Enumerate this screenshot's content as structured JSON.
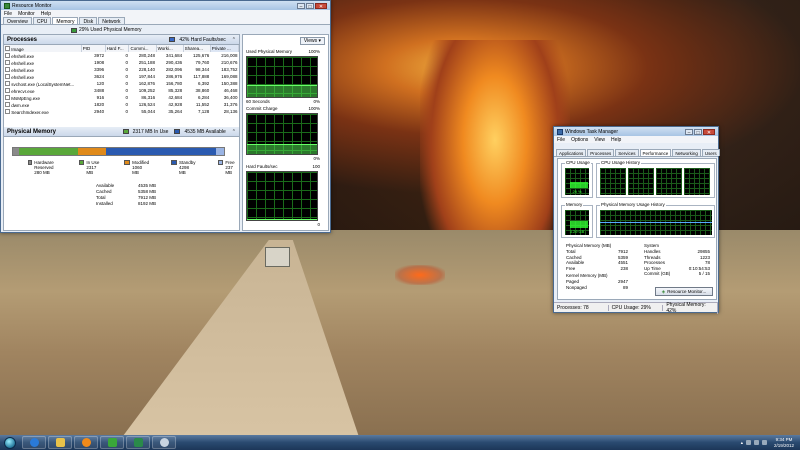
{
  "resmon": {
    "title": "Resource Monitor",
    "menu": [
      "File",
      "Monitor",
      "Help"
    ],
    "tabs": [
      "Overview",
      "CPU",
      "Memory",
      "Disk",
      "Network"
    ],
    "active_tab": "Memory",
    "status": "29% Used Physical Memory",
    "processes": {
      "header": "Processes",
      "status": "42% Hard Faults/sec",
      "columns": [
        "Image",
        "PID",
        "Hard F...",
        "Commi...",
        "Worki...",
        "Sharea...",
        "Private ..."
      ],
      "rows": [
        [
          "ehshell.exe",
          "3972",
          "0",
          "280,248",
          "341,684",
          "125,676",
          "216,008"
        ],
        [
          "ehshell.exe",
          "1908",
          "0",
          "251,188",
          "290,436",
          "79,760",
          "210,676"
        ],
        [
          "ehshell.exe",
          "3396",
          "0",
          "228,140",
          "282,096",
          "98,344",
          "183,752"
        ],
        [
          "ehshell.exe",
          "3624",
          "0",
          "197,844",
          "286,976",
          "117,888",
          "169,088"
        ],
        [
          "svchost.exe (LocalSystemNet...",
          "120",
          "0",
          "162,876",
          "156,780",
          "6,392",
          "150,388"
        ],
        [
          "ehrecvr.exe",
          "3488",
          "0",
          "109,252",
          "85,328",
          "38,860",
          "46,468"
        ],
        [
          "MsMpEng.exe",
          "916",
          "0",
          "86,316",
          "42,684",
          "6,284",
          "36,400"
        ],
        [
          "dwm.exe",
          "1820",
          "0",
          "126,524",
          "42,928",
          "11,552",
          "31,376"
        ],
        [
          "SearchIndexer.exe",
          "2940",
          "0",
          "55,044",
          "35,264",
          "7,128",
          "28,136"
        ]
      ]
    },
    "physical_memory": {
      "header": "Physical Memory",
      "in_use_label": "2317 MB In Use",
      "available_label": "4535 MB Available",
      "legend": [
        {
          "name": "Hardware Reserved",
          "value": "280 MB",
          "color": "#8a8a8a"
        },
        {
          "name": "In Use",
          "value": "2317 MB",
          "color": "#5aa83a"
        },
        {
          "name": "Modified",
          "value": "1060 MB",
          "color": "#e08a1a"
        },
        {
          "name": "Standby",
          "value": "4298 MB",
          "color": "#2a5ab0"
        },
        {
          "name": "Free",
          "value": "237 MB",
          "color": "#9ab4e4"
        }
      ],
      "bar_fractions": [
        0.03,
        0.28,
        0.13,
        0.52,
        0.04
      ],
      "totals": [
        {
          "label": "Available",
          "value": "4535 MB"
        },
        {
          "label": "Cached",
          "value": "5358 MB"
        },
        {
          "label": "Total",
          "value": "7912 MB"
        },
        {
          "label": "Installed",
          "value": "8192 MB"
        }
      ]
    },
    "graphs": {
      "views_label": "Views",
      "used_physical": {
        "label": "Used Physical Memory",
        "max": "100%",
        "min": "0%",
        "level": 0.29,
        "time": "60 Seconds"
      },
      "commit_charge": {
        "label": "Commit Charge",
        "max": "100%",
        "min": "0%",
        "level": 0.25
      },
      "hard_faults": {
        "label": "Hard Faults/sec",
        "max": "100",
        "min": "0",
        "level": 0.02
      }
    }
  },
  "taskmgr": {
    "title": "Windows Task Manager",
    "menu": [
      "File",
      "Options",
      "View",
      "Help"
    ],
    "tabs": [
      "Applications",
      "Processes",
      "Services",
      "Performance",
      "Networking",
      "Users"
    ],
    "active_tab": "Performance",
    "cpu_usage_label": "CPU Usage",
    "cpu_usage_value": "29 %",
    "cpu_history_label": "CPU Usage History",
    "memory_label": "Memory",
    "memory_value": "3.29 GB",
    "memory_history_label": "Physical Memory Usage History",
    "physical_memory": {
      "header": "Physical Memory (MB)",
      "rows": [
        [
          "Total",
          "7912"
        ],
        [
          "Cached",
          "5359"
        ],
        [
          "Available",
          "4551"
        ],
        [
          "Free",
          "238"
        ]
      ]
    },
    "kernel_memory": {
      "header": "Kernel Memory (MB)",
      "rows": [
        [
          "Paged",
          "2947"
        ],
        [
          "Nonpaged",
          "89"
        ]
      ]
    },
    "system": {
      "header": "System",
      "rows": [
        [
          "Handles",
          "29855"
        ],
        [
          "Threads",
          "1223"
        ],
        [
          "Processes",
          "78"
        ],
        [
          "Up Time",
          "0:10:54:53"
        ],
        [
          "Commit (GB)",
          "5 / 15"
        ]
      ]
    },
    "resource_monitor_button": "Resource Monitor...",
    "statusbar": [
      "Processes: 78",
      "CPU Usage: 29%",
      "Physical Memory: 42%"
    ]
  },
  "taskbar": {
    "time": "9:34 PM",
    "date": "2/19/2012"
  }
}
